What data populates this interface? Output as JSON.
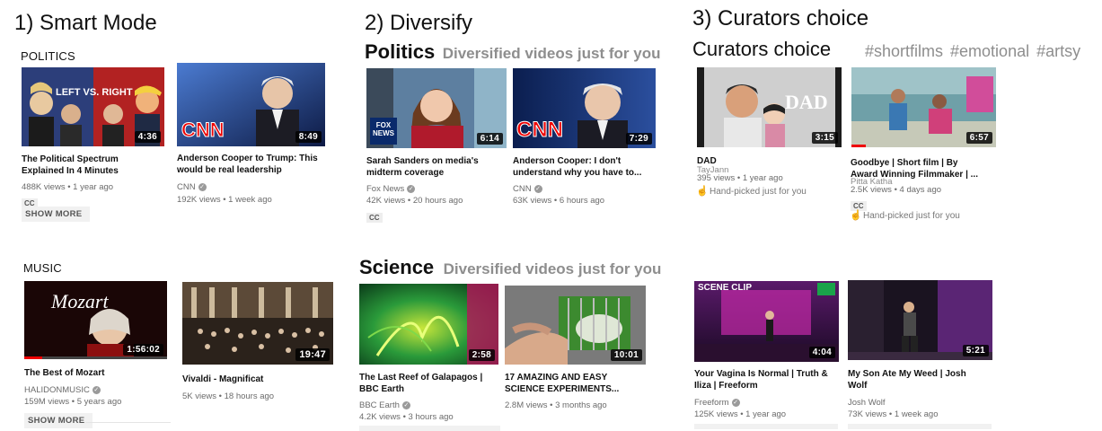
{
  "panels": [
    {
      "title": "1)  Smart Mode"
    },
    {
      "title": "2) Diversify"
    },
    {
      "title": "3)  Curators choice"
    }
  ],
  "smart": {
    "politics_heading": "POLITICS",
    "music_heading": "MUSIC",
    "show_more": "SHOW MORE",
    "politics_videos": [
      {
        "title": "The Political Spectrum Explained In 4 Minutes",
        "duration": "4:36",
        "overlay_text": "LEFT VS. RIGHT",
        "line1": "488K views • 1 year ago",
        "cc": "CC"
      },
      {
        "title": "Anderson Cooper to Trump: This would be real leadership",
        "duration": "8:49",
        "overlay_text": "CNN",
        "channel": "CNN",
        "line2": "192K views • 1 week ago"
      }
    ],
    "music_videos": [
      {
        "title": "The Best of Mozart",
        "duration": "1:56:02",
        "overlay_text": "Mozart",
        "channel": "HALIDONMUSIC",
        "line2": "159M views • 5 years ago"
      },
      {
        "title": "Vivaldi - Magnificat",
        "duration": "19:47",
        "line1": "5K views • 18 hours ago"
      }
    ]
  },
  "diversify": {
    "sections": [
      {
        "heading": "Politics",
        "subheading": "Diversified videos just for you",
        "videos": [
          {
            "title": "Sarah Sanders on media's midterm coverage",
            "duration": "6:14",
            "overlay_text": "FOX NEWS",
            "channel": "Fox News",
            "line2": "42K views • 20 hours ago",
            "cc": "CC"
          },
          {
            "title": "Anderson Cooper: I don't understand why you have to...",
            "duration": "7:29",
            "overlay_text": "CNN",
            "channel": "CNN",
            "line2": "63K views • 6 hours ago"
          }
        ]
      },
      {
        "heading": "Science",
        "subheading": "Diversified videos just for you",
        "videos": [
          {
            "title": "The Last Reef of Galapagos | BBC Earth",
            "duration": "2:58",
            "channel": "BBC Earth",
            "line2": "4.2K views • 3 hours ago"
          },
          {
            "title": "17 AMAZING AND EASY SCIENCE EXPERIMENTS...",
            "duration": "10:01",
            "line1": "2.8M views • 3 months ago"
          }
        ]
      }
    ]
  },
  "curators": {
    "heading": "Curators choice",
    "tags": [
      "#shortfilms",
      "#emotional",
      "#artsy"
    ],
    "hand_picked": "Hand-picked just for you",
    "top_videos": [
      {
        "title": "DAD",
        "duration": "3:15",
        "overlay_text": "DAD",
        "channel": "TayJann",
        "line2": "395 views • 1 year ago"
      },
      {
        "title": "Goodbye | Short film | By Award Winning Filmmaker | ...",
        "duration": "6:57",
        "channel": "Pitta Katha",
        "line2": "2.5K views • 4 days ago",
        "cc": "CC"
      }
    ],
    "bottom_videos": [
      {
        "title": "Your Vagina Is Normal | Truth & Iliza | Freeform",
        "duration": "4:04",
        "overlay_text": "SCENE CLIP",
        "channel": "Freeform",
        "line2": "125K views • 1 year ago"
      },
      {
        "title": "My Son Ate My Weed | Josh Wolf",
        "duration": "5:21",
        "channel": "Josh Wolf",
        "line2": "73K views • 1 week ago"
      }
    ]
  },
  "colors": {
    "accent_red": "#e00000",
    "muted_text": "#6b6b6b",
    "subheading_gray": "#8e8e8e"
  },
  "icons": {
    "verified": "verified-check-icon",
    "hand": "hand-pointer-icon"
  }
}
